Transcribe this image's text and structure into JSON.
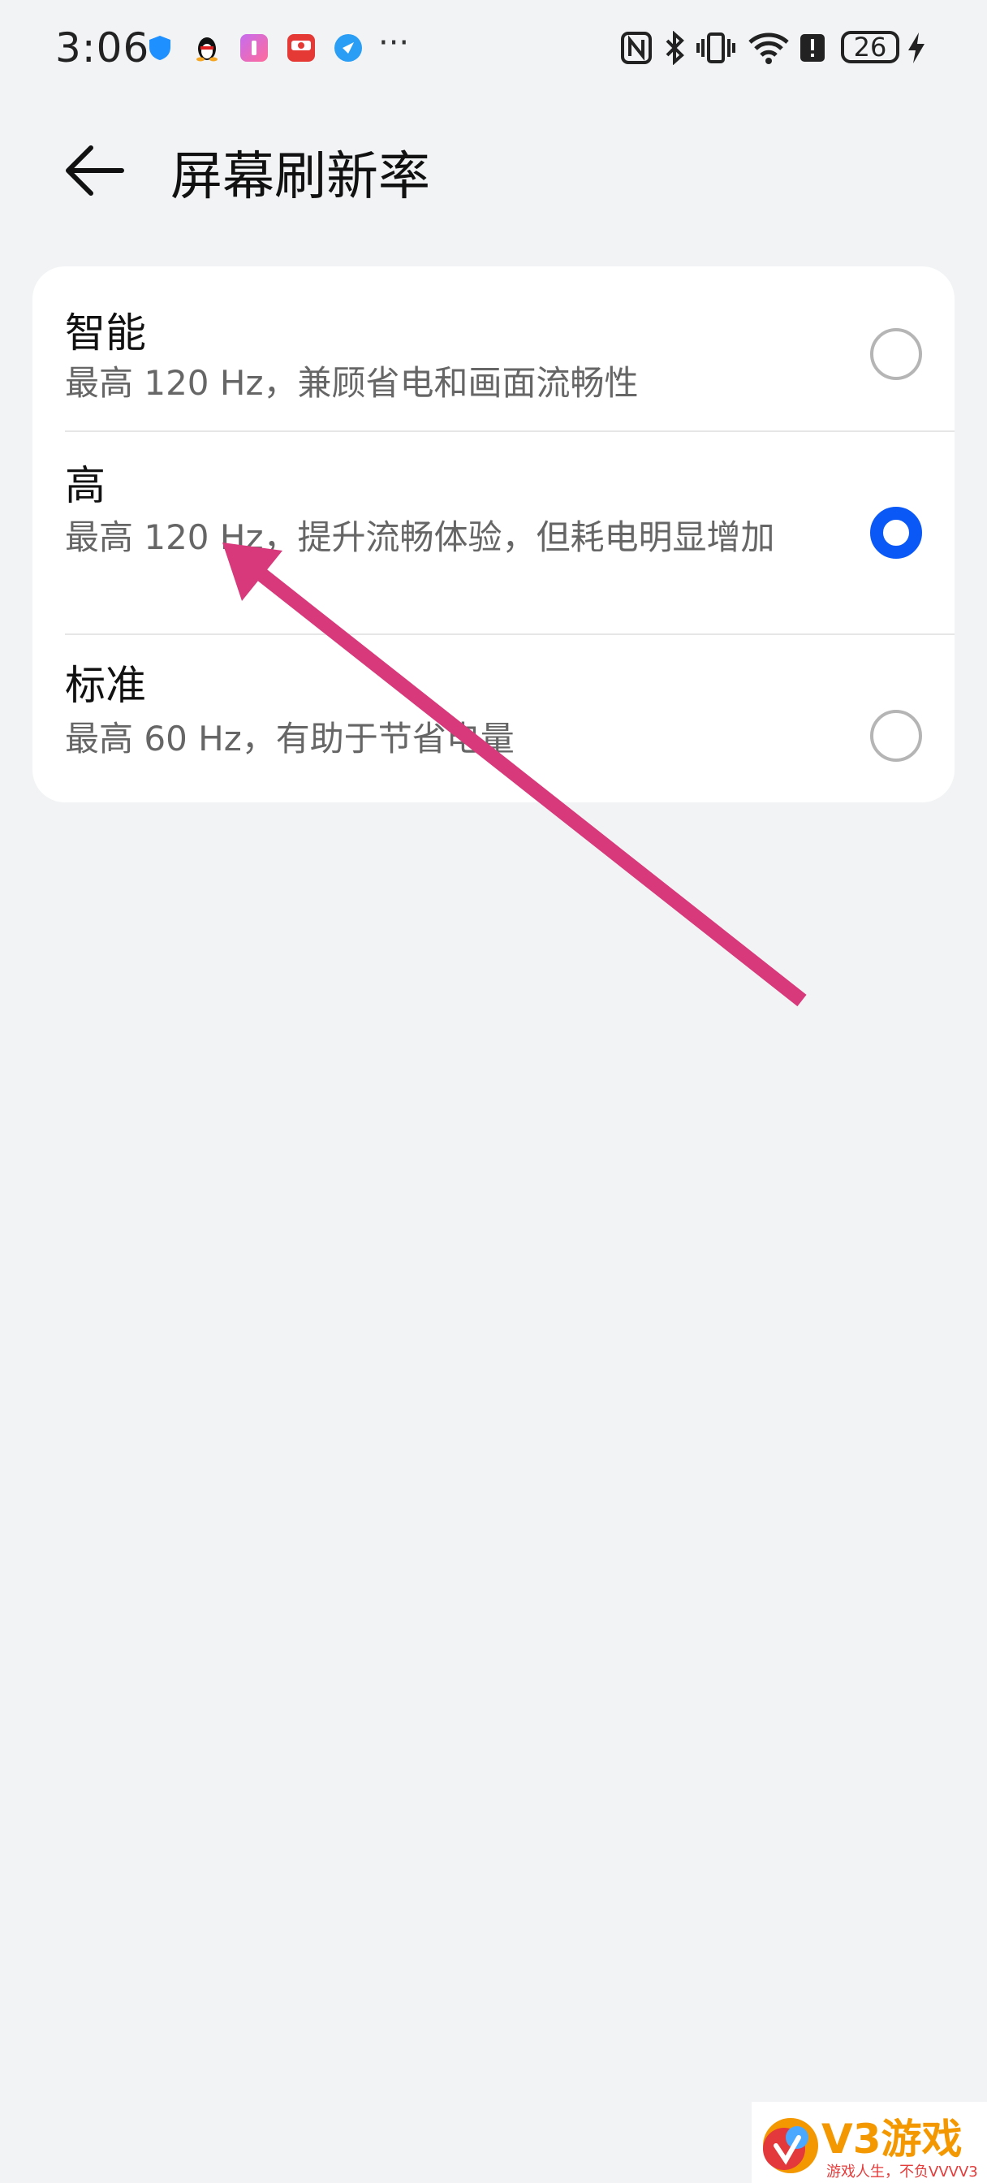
{
  "status_bar": {
    "time": "3:06",
    "notification_icons": [
      "shield-app-icon",
      "qq-penguin-icon",
      "purple-app-icon",
      "red-app-icon",
      "compass-app-icon"
    ],
    "overflow": "···",
    "system_icons": [
      "nfc-icon",
      "bluetooth-icon",
      "vibrate-icon",
      "wifi-icon",
      "alert-icon"
    ],
    "battery_level": "26",
    "charging_icon": "bolt-icon"
  },
  "header": {
    "back_icon": "arrow-left-icon",
    "title": "屏幕刷新率"
  },
  "options": [
    {
      "title": "智能",
      "description": "最高 120 Hz，兼顾省电和画面流畅性",
      "selected": false
    },
    {
      "title": "高",
      "description": "最高 120 Hz，提升流畅体验，但耗电明显增加",
      "selected": true
    },
    {
      "title": "标准",
      "description": "最高 60 Hz，有助于节省电量",
      "selected": false
    }
  ],
  "annotation": {
    "color": "#d8397a",
    "icon": "pointer-arrow-icon"
  },
  "watermark": {
    "brand": "V3游戏",
    "slogan": "游戏人生，不负VVVV3"
  },
  "colors": {
    "accent": "#0a59f7",
    "background": "#f1f3f5",
    "card": "#ffffff"
  }
}
